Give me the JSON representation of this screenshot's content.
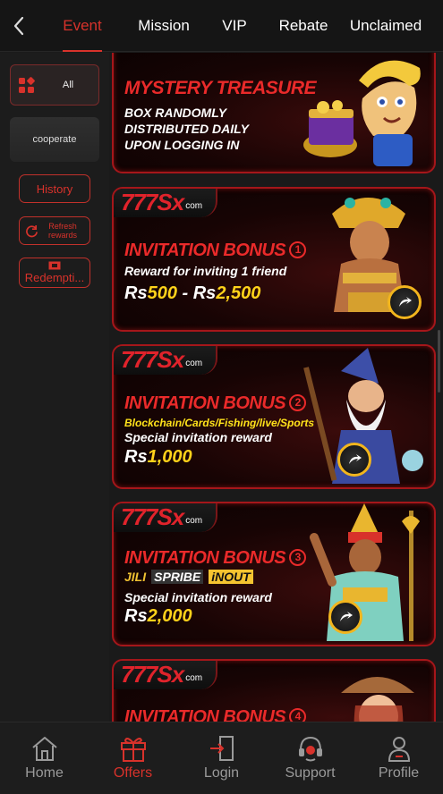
{
  "header": {
    "back_icon": "chevron-left-icon",
    "tabs": [
      {
        "label": "Event",
        "active": true
      },
      {
        "label": "Mission",
        "active": false
      },
      {
        "label": "VIP",
        "active": false
      },
      {
        "label": "Rebate",
        "active": false
      },
      {
        "label": "Unclaimed",
        "active": false
      }
    ]
  },
  "sidebar": {
    "all_label": "All",
    "cooperate_label": "cooperate",
    "history_label": "History",
    "refresh_label_1": "Refresh",
    "refresh_label_2": "rewards",
    "redemption_label": "Redempti..."
  },
  "cards": [
    {
      "title": "MYSTERY TREASURE",
      "lines": [
        "BOX RANDOMLY",
        "DISTRIBUTED DAILY",
        "UPON LOGGING IN"
      ]
    },
    {
      "brand": "777Sx",
      "brand_suffix": "com",
      "title": "INVITATION BONUS",
      "number": "1",
      "line": "Reward for inviting 1 friend",
      "currency": "Rs",
      "amount_a": "500",
      "amount_sep": " - ",
      "amount_b": "2,500"
    },
    {
      "brand": "777Sx",
      "brand_suffix": "com",
      "title": "INVITATION BONUS",
      "number": "2",
      "yellow_line": "Blockchain/Cards/Fishing/live/Sports",
      "line": "Special invitation reward",
      "currency": "Rs",
      "amount": "1,000"
    },
    {
      "brand": "777Sx",
      "brand_suffix": "com",
      "title": "INVITATION BONUS",
      "number": "3",
      "logos": [
        "JILI",
        "SPRIBE",
        "iNOUT"
      ],
      "line": "Special invitation reward",
      "currency": "Rs",
      "amount": "2,000"
    },
    {
      "brand": "777Sx",
      "brand_suffix": "com",
      "title": "INVITATION BONUS",
      "number": "4"
    }
  ],
  "bottom_nav": [
    {
      "label": "Home",
      "icon": "home-icon",
      "active": false
    },
    {
      "label": "Offers",
      "icon": "gift-icon",
      "active": true
    },
    {
      "label": "Login",
      "icon": "login-icon",
      "active": false
    },
    {
      "label": "Support",
      "icon": "headset-icon",
      "active": false
    },
    {
      "label": "Profile",
      "icon": "user-icon",
      "active": false
    }
  ],
  "colors": {
    "accent": "#d8322b",
    "background": "#1a1a1a",
    "gold": "#f2b51d"
  }
}
